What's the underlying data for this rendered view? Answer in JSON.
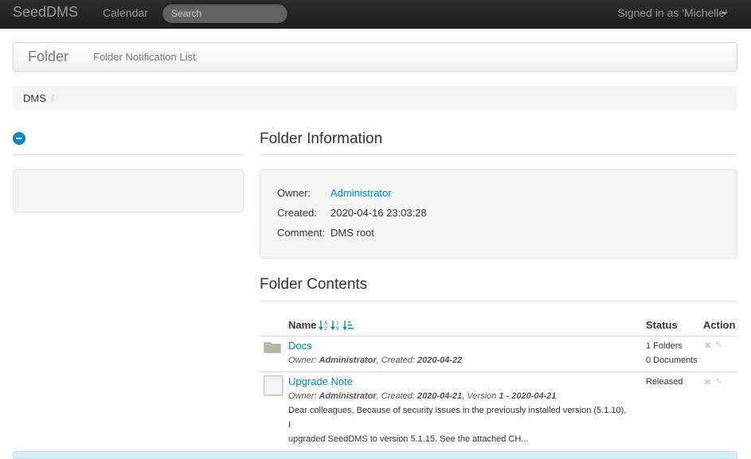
{
  "navbar": {
    "brand": "SeedDMS",
    "calendar_label": "Calendar",
    "search_placeholder": "Search",
    "user_menu_label": "Signed in as 'Michelle'"
  },
  "pagebar": {
    "title": "Folder",
    "link": "Folder Notification List"
  },
  "breadcrumb": {
    "root": "DMS",
    "divider": "/"
  },
  "folder_info": {
    "heading": "Folder Information",
    "owner_label": "Owner:",
    "owner_value": "Administrator",
    "created_label": "Created:",
    "created_value": "2020-04-16 23:03:28",
    "comment_label": "Comment:",
    "comment_value": "DMS root"
  },
  "folder_contents": {
    "heading": "Folder Contents",
    "columns": {
      "name": "Name",
      "status": "Status",
      "action": "Action"
    },
    "rows": [
      {
        "type": "folder",
        "icon": "folder-icon",
        "title": "Docs",
        "meta_owner_label": "Owner: ",
        "meta_owner": "Administrator",
        "meta_created_label": ", Created: ",
        "meta_created": "2020-04-22",
        "status_line1": "1 Folders",
        "status_line2": "0 Documents"
      },
      {
        "type": "document",
        "icon": "document-icon",
        "title": "Upgrade Note",
        "meta_owner_label": "Owner: ",
        "meta_owner": "Administrator",
        "meta_created_label": ", Created: ",
        "meta_created": "2020-04-21",
        "meta_version_label": ", Version ",
        "meta_version": "1 - 2020-04-21",
        "desc_line1": "Dear colleagues, Because of security issues in the previously installed version (5.1.10), I",
        "desc_line2": "upgraded SeedDMS to version 5.1.15. See the attached CH...",
        "status_line1": "Released"
      }
    ],
    "action_delete_symbol": "✖",
    "action_edit_symbol": "✎"
  },
  "colors": {
    "link": "#0088cc",
    "navbar_bg": "#222222",
    "well_bg": "#f5f5f5"
  }
}
